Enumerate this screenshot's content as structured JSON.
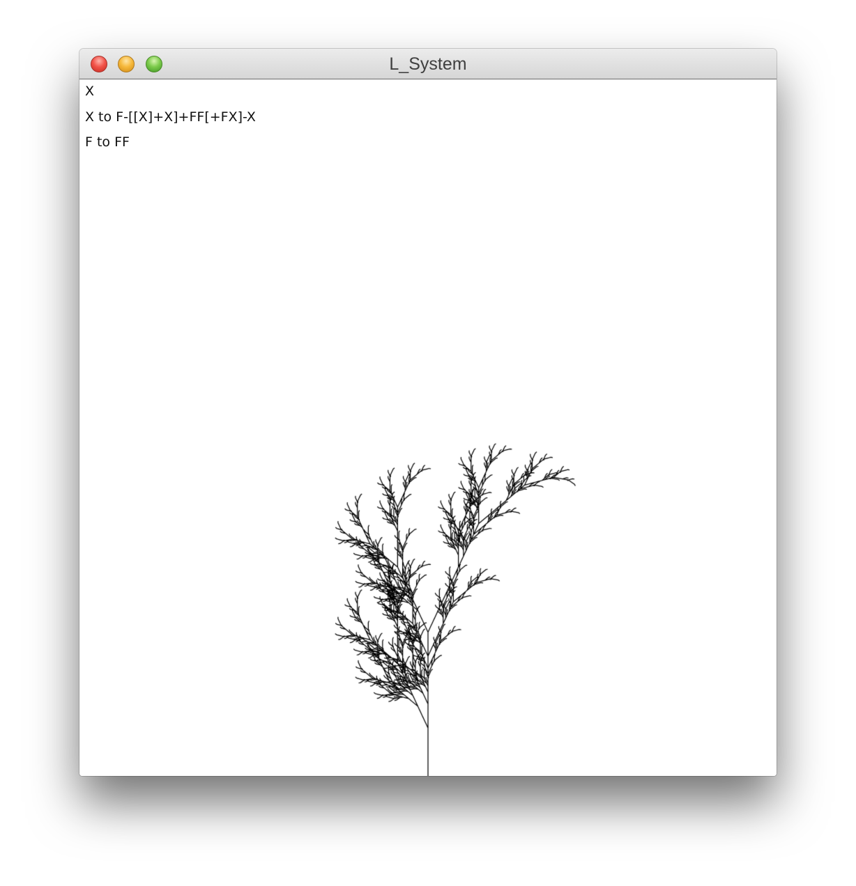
{
  "window": {
    "title": "L_System"
  },
  "lsystem": {
    "axiom": "X",
    "rules": [
      "X to F-[[X]+X]+FF[+FX]-X",
      "F to FF"
    ]
  },
  "colors": {
    "stroke": "#000000",
    "background": "#ffffff"
  }
}
